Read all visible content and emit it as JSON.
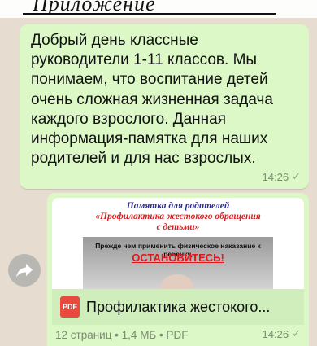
{
  "top_fragment": {
    "text": "Приложение"
  },
  "message_1": {
    "text": "Добрый день классные\nруководители 1-11 классов. Мы\nпонимаем, что воспитание детей\nочень  сложная жизненная задача\nкаждого взрослого.  Данная\nинформация-памятка для  наших\nродителей и для нас взрослых.",
    "time": "14:26",
    "tick": "✓"
  },
  "message_2": {
    "preview": {
      "title": "Памятка для родителей",
      "subtitle": "«Профилактика жестокого обращения\nс детьми»",
      "line1": "Прежде чем применить физическое наказание к ребенку,",
      "line2": "ОСТАНОВИТЕСЬ!"
    },
    "file_icon_label": "PDF",
    "file_name": "Профилактика  жестокого...",
    "file_info": "12 страниц • 1,4 МБ • PDF",
    "time": "14:26",
    "tick": "✓"
  },
  "icons": {
    "forward": "forward-icon",
    "file": "pdf-file-icon"
  },
  "colors": {
    "chat_background": "#e6ddd0",
    "outgoing_bubble": "#dcf8c6",
    "pdf_red": "#e94a3f"
  }
}
